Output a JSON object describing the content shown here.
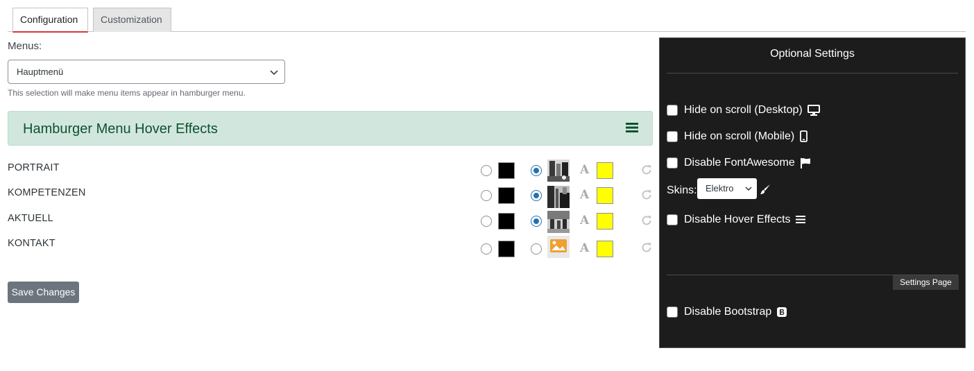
{
  "tabs": [
    {
      "label": "Configuration",
      "active": true
    },
    {
      "label": "Customization",
      "active": false
    }
  ],
  "menus": {
    "label": "Menus:",
    "selected": "Hauptmenü",
    "help": "This selection will make menu items appear in hamburger menu."
  },
  "hover_section": {
    "title": "Hamburger Menu Hover Effects",
    "icon": "bars-icon"
  },
  "menu_items": [
    {
      "label": "PORTRAIT",
      "color_selected": false,
      "image_selected": true,
      "bg_color": "#000000",
      "text_color": "#ffff00",
      "image": "photo-portrait"
    },
    {
      "label": "KOMPETENZEN",
      "color_selected": false,
      "image_selected": true,
      "bg_color": "#000000",
      "text_color": "#ffff00",
      "image": "photo-kompetenzen"
    },
    {
      "label": "AKTUELL",
      "color_selected": false,
      "image_selected": true,
      "bg_color": "#000000",
      "text_color": "#ffff00",
      "image": "photo-aktuell"
    },
    {
      "label": "KONTAKT",
      "color_selected": false,
      "image_selected": false,
      "bg_color": "#000000",
      "text_color": "#ffff00",
      "image": "image-placeholder-icon"
    }
  ],
  "font_glyph": "A",
  "save_button": "Save Changes",
  "panel": {
    "title": "Optional Settings",
    "options": [
      {
        "label": "Hide on scroll (Desktop)",
        "icon": "desktop-icon",
        "checked": false
      },
      {
        "label": "Hide on scroll (Mobile)",
        "icon": "mobile-icon",
        "checked": false
      },
      {
        "label": "Disable FontAwesome",
        "icon": "flag-icon",
        "checked": false
      }
    ],
    "skins": {
      "label": "Skins:",
      "selected": "Elektro",
      "icon": "paint-brush-icon"
    },
    "hover_option": {
      "label": "Disable Hover Effects",
      "icon": "bars-icon",
      "checked": false
    },
    "settings_page_button": "Settings Page",
    "bootstrap_option": {
      "label": "Disable Bootstrap",
      "icon": "bootstrap-icon",
      "checked": false
    }
  },
  "colors": {
    "accent": "#2271b1",
    "tab_active_border": "#d63638",
    "success_bg": "#d1e7dd",
    "success_text": "#0f5132",
    "panel_bg": "#1c1c1c",
    "button_secondary": "#6c757d"
  }
}
